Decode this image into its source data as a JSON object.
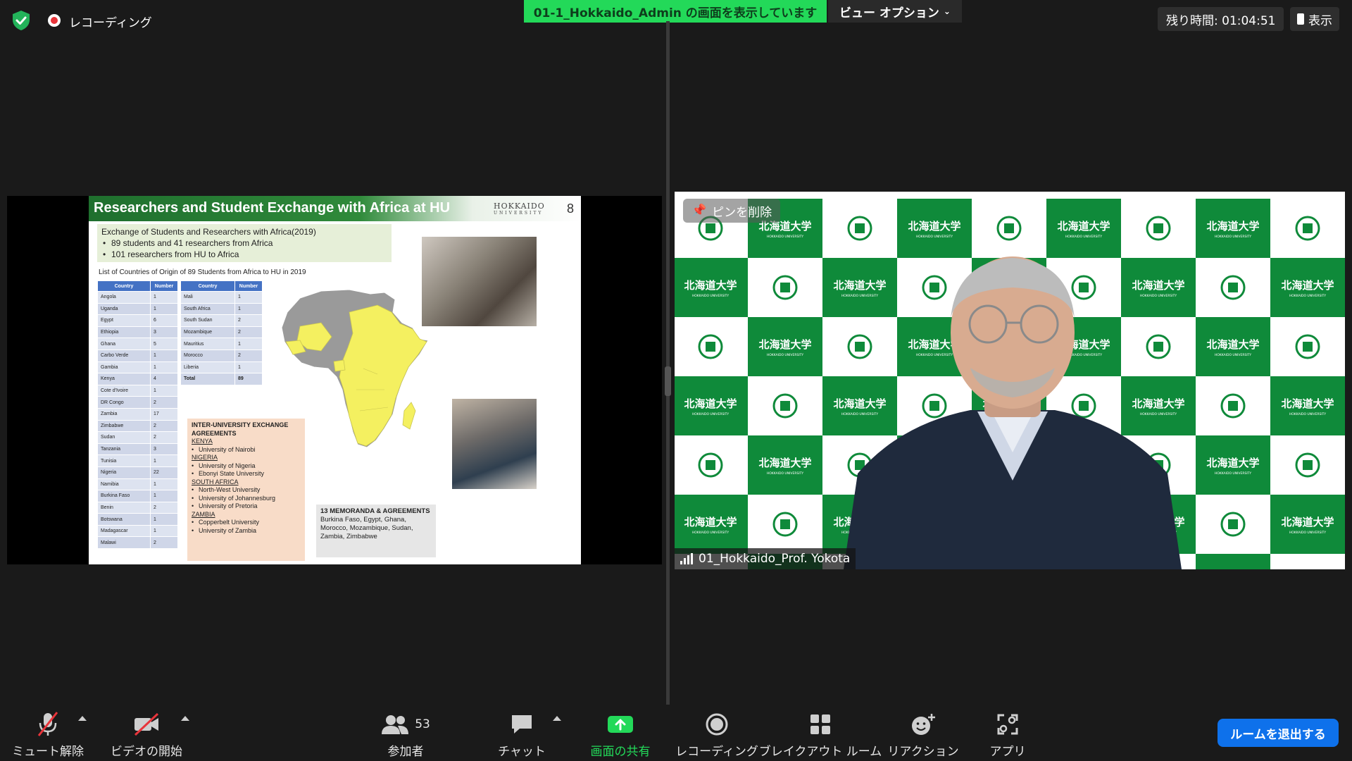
{
  "top": {
    "recording_label": "レコーディング",
    "share_banner": "01-1_Hokkaido_Admin の画面を表示しています",
    "view_options": "ビュー オプション",
    "timer": "残り時間: 01:04:51",
    "show_label": "表示"
  },
  "slide": {
    "title": "Researchers and Student Exchange with Africa at HU",
    "logo_text": "HOKKAIDO",
    "logo_sub": "UNIVERSITY",
    "page_number": "8",
    "intro_title": "Exchange of Students and Researchers with Africa(2019)",
    "intro_bullets": [
      "89 students and 41 researchers from Africa",
      "101 researchers from HU to Africa"
    ],
    "list_title": "List of Countries of Origin of 89 Students from Africa to HU in 2019",
    "table_headers": [
      "Country",
      "Number"
    ],
    "table1": [
      [
        "Angola",
        "1"
      ],
      [
        "Uganda",
        "1"
      ],
      [
        "Egypt",
        "6"
      ],
      [
        "Ethiopia",
        "3"
      ],
      [
        "Ghana",
        "5"
      ],
      [
        "Carbo Verde",
        "1"
      ],
      [
        "Gambia",
        "1"
      ],
      [
        "Kenya",
        "4"
      ],
      [
        "Cote d'Ivoire",
        "1"
      ],
      [
        "DR Congo",
        "2"
      ],
      [
        "Zambia",
        "17"
      ],
      [
        "Zimbabwe",
        "2"
      ],
      [
        "Sudan",
        "2"
      ],
      [
        "Tanzania",
        "3"
      ],
      [
        "Tunisia",
        "1"
      ],
      [
        "Nigeria",
        "22"
      ],
      [
        "Namibia",
        "1"
      ],
      [
        "Burkina Faso",
        "1"
      ],
      [
        "Benin",
        "2"
      ],
      [
        "Botswana",
        "1"
      ],
      [
        "Madagascar",
        "1"
      ],
      [
        "Malawi",
        "2"
      ]
    ],
    "table2": [
      [
        "Mali",
        "1"
      ],
      [
        "South Africa",
        "1"
      ],
      [
        "South Sudan",
        "2"
      ],
      [
        "Mozambique",
        "2"
      ],
      [
        "Mauritius",
        "1"
      ],
      [
        "Morocco",
        "2"
      ],
      [
        "Liberia",
        "1"
      ],
      [
        "Total",
        "89"
      ]
    ],
    "agreements": {
      "heading": "INTER-UNIVERSITY EXCHANGE AGREEMENTS",
      "groups": [
        {
          "country": "KENYA",
          "unis": [
            "University of Nairobi"
          ]
        },
        {
          "country": "NIGERIA",
          "unis": [
            "University of Nigeria",
            "Ebonyi State University"
          ]
        },
        {
          "country": "SOUTH AFRICA",
          "unis": [
            "North-West University",
            "University of Johannesburg",
            "University of Pretoria"
          ]
        },
        {
          "country": "ZAMBIA",
          "unis": [
            "Copperbelt University",
            "University of Zambia"
          ]
        }
      ]
    },
    "memoranda": {
      "heading": "13 MEMORANDA & AGREEMENTS",
      "body": "Burkina Faso, Egypt, Ghana, Morocco, Mozambique, Sudan, Zambia, Zimbabwe"
    }
  },
  "video": {
    "pin_label": "ピンを削除",
    "participant_name": "01_Hokkaido_Prof. Yokota",
    "bg_text": "北海道大学",
    "bg_sub": "HOKKAIDO UNIVERSITY",
    "bg_green": "#0f8a3a"
  },
  "toolbar": {
    "mute": "ミュート解除",
    "video": "ビデオの開始",
    "participants": "参加者",
    "participant_count": "53",
    "chat": "チャット",
    "share": "画面の共有",
    "record": "レコーディング",
    "breakout": "ブレイクアウト ルーム",
    "reactions": "リアクション",
    "apps": "アプリ",
    "leave": "ルームを退出する"
  },
  "colors": {
    "share_green": "#23d959",
    "leave_blue": "#0e71eb",
    "record_red": "#e8343a"
  }
}
